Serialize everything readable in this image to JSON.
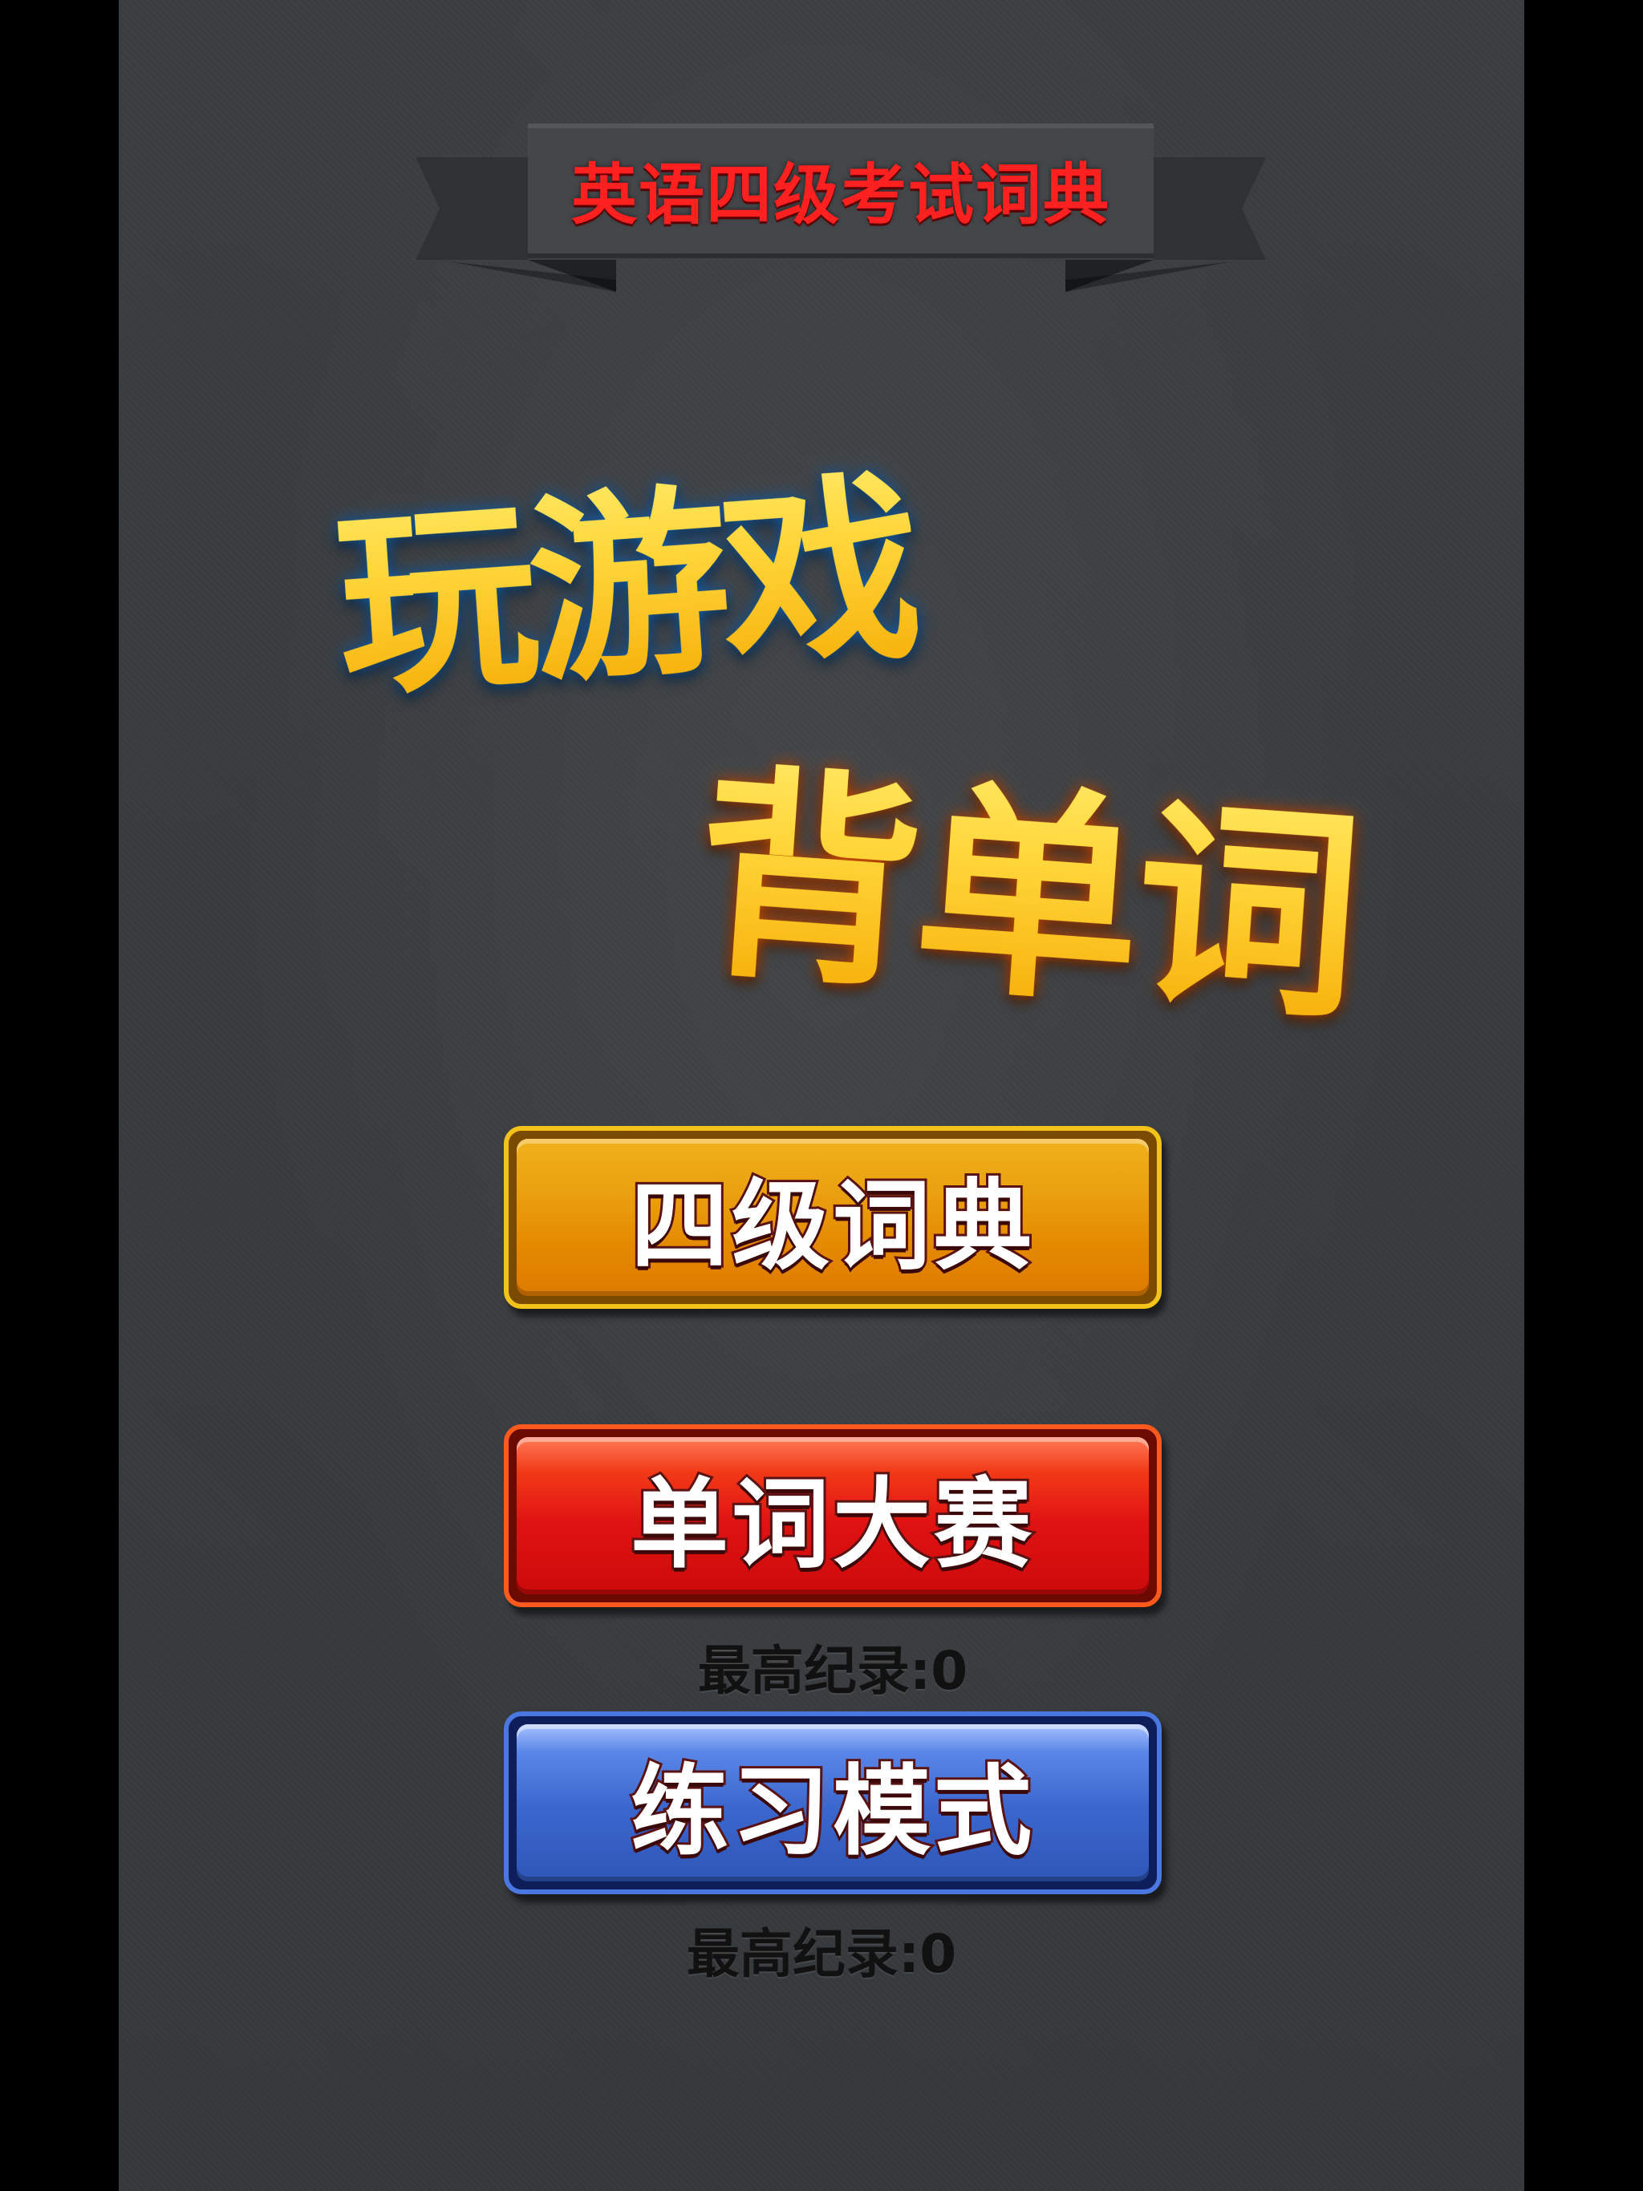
{
  "header": {
    "banner_title": "英语四级考试词典"
  },
  "hero": {
    "line1": "玩游戏",
    "line2": "背单词"
  },
  "menu": {
    "dictionary_label": "四级词典",
    "contest_label": "单词大赛",
    "contest_record": "最高纪录:0",
    "practice_label": "练习模式",
    "practice_record": "最高纪录:0"
  },
  "colors": {
    "background": "#393c3f",
    "banner_text": "#ff2020",
    "title_yellow": "#ffd83a",
    "button_orange": "#e48800",
    "button_red": "#e01212",
    "button_blue": "#3a66cc"
  }
}
